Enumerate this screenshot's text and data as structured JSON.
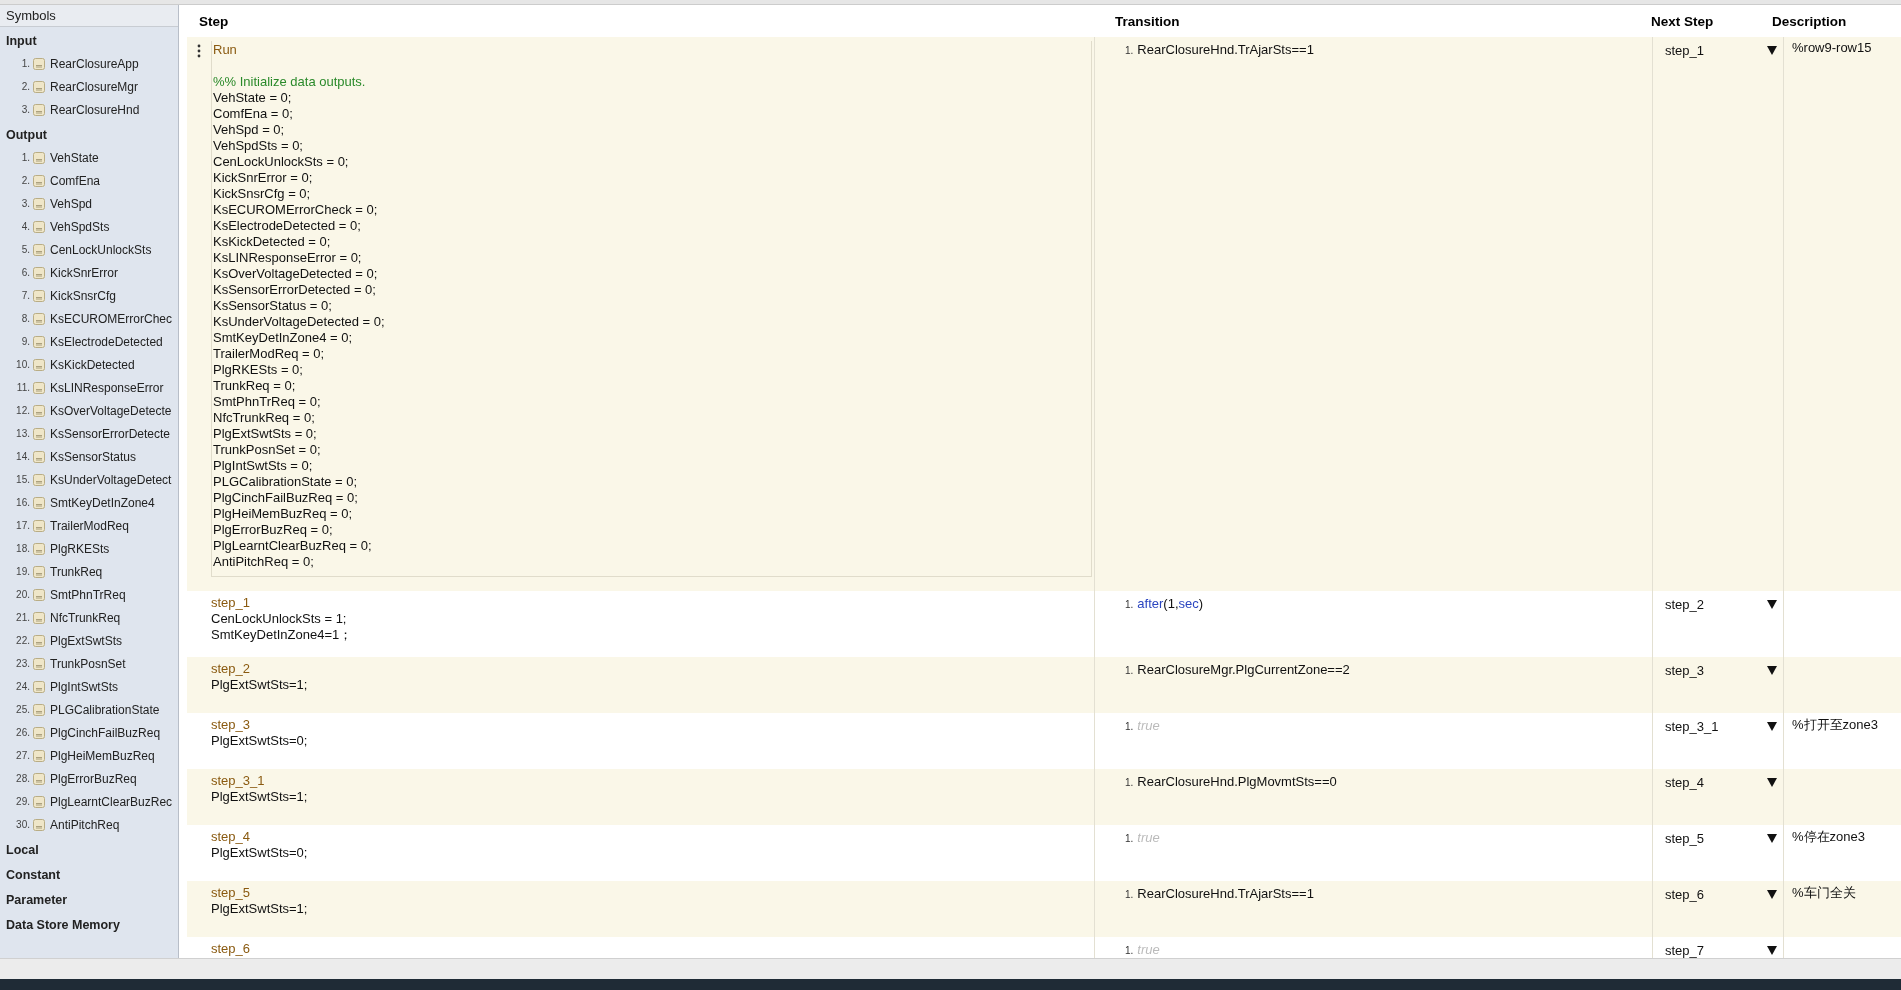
{
  "sidebar": {
    "title": "Symbols",
    "sections": [
      {
        "label": "Input",
        "items": [
          {
            "number": "1.",
            "name": "RearClosureApp"
          },
          {
            "number": "2.",
            "name": "RearClosureMgr"
          },
          {
            "number": "3.",
            "name": "RearClosureHnd"
          }
        ]
      },
      {
        "label": "Output",
        "items": [
          {
            "number": "1.",
            "name": "VehState"
          },
          {
            "number": "2.",
            "name": "ComfEna"
          },
          {
            "number": "3.",
            "name": "VehSpd"
          },
          {
            "number": "4.",
            "name": "VehSpdSts"
          },
          {
            "number": "5.",
            "name": "CenLockUnlockSts"
          },
          {
            "number": "6.",
            "name": "KickSnrError"
          },
          {
            "number": "7.",
            "name": "KickSnsrCfg"
          },
          {
            "number": "8.",
            "name": "KsECUROMErrorChec"
          },
          {
            "number": "9.",
            "name": "KsElectrodeDetected"
          },
          {
            "number": "10.",
            "name": "KsKickDetected"
          },
          {
            "number": "11.",
            "name": "KsLINResponseError"
          },
          {
            "number": "12.",
            "name": "KsOverVoltageDetecte"
          },
          {
            "number": "13.",
            "name": "KsSensorErrorDetecte"
          },
          {
            "number": "14.",
            "name": "KsSensorStatus"
          },
          {
            "number": "15.",
            "name": "KsUnderVoltageDetect"
          },
          {
            "number": "16.",
            "name": "SmtKeyDetInZone4"
          },
          {
            "number": "17.",
            "name": "TrailerModReq"
          },
          {
            "number": "18.",
            "name": "PlgRKESts"
          },
          {
            "number": "19.",
            "name": "TrunkReq"
          },
          {
            "number": "20.",
            "name": "SmtPhnTrReq"
          },
          {
            "number": "21.",
            "name": "NfcTrunkReq"
          },
          {
            "number": "22.",
            "name": "PlgExtSwtSts"
          },
          {
            "number": "23.",
            "name": "TrunkPosnSet"
          },
          {
            "number": "24.",
            "name": "PlgIntSwtSts"
          },
          {
            "number": "25.",
            "name": "PLGCalibrationState"
          },
          {
            "number": "26.",
            "name": "PlgCinchFailBuzReq"
          },
          {
            "number": "27.",
            "name": "PlgHeiMemBuzReq"
          },
          {
            "number": "28.",
            "name": "PlgErrorBuzReq"
          },
          {
            "number": "29.",
            "name": "PlgLearntClearBuzRec"
          },
          {
            "number": "30.",
            "name": "AntiPitchReq"
          }
        ]
      },
      {
        "label": "Local"
      },
      {
        "label": "Constant"
      },
      {
        "label": "Parameter"
      },
      {
        "label": "Data Store Memory"
      }
    ]
  },
  "table": {
    "columns": [
      "Step",
      "Transition",
      "Next Step",
      "Description"
    ],
    "rows": [
      {
        "step": "Run",
        "code": [
          {
            "kind": "comment",
            "text": "%% Initialize data outputs."
          },
          {
            "kind": "code",
            "text": "VehState = 0;"
          },
          {
            "kind": "code",
            "text": "ComfEna = 0;"
          },
          {
            "kind": "code",
            "text": "VehSpd = 0;"
          },
          {
            "kind": "code",
            "text": "VehSpdSts = 0;"
          },
          {
            "kind": "code",
            "text": "CenLockUnlockSts = 0;"
          },
          {
            "kind": "code",
            "text": "KickSnrError = 0;"
          },
          {
            "kind": "code",
            "text": "KickSnsrCfg = 0;"
          },
          {
            "kind": "code",
            "text": "KsECUROMErrorCheck = 0;"
          },
          {
            "kind": "code",
            "text": "KsElectrodeDetected = 0;"
          },
          {
            "kind": "code",
            "text": "KsKickDetected = 0;"
          },
          {
            "kind": "code",
            "text": "KsLINResponseError = 0;"
          },
          {
            "kind": "code",
            "text": "KsOverVoltageDetected = 0;"
          },
          {
            "kind": "code",
            "text": "KsSensorErrorDetected = 0;"
          },
          {
            "kind": "code",
            "text": "KsSensorStatus = 0;"
          },
          {
            "kind": "code",
            "text": "KsUnderVoltageDetected = 0;"
          },
          {
            "kind": "code",
            "text": "SmtKeyDetInZone4 = 0;"
          },
          {
            "kind": "code",
            "text": "TrailerModReq = 0;"
          },
          {
            "kind": "code",
            "text": "PlgRKESts = 0;"
          },
          {
            "kind": "code",
            "text": "TrunkReq = 0;"
          },
          {
            "kind": "code",
            "text": "SmtPhnTrReq = 0;"
          },
          {
            "kind": "code",
            "text": "NfcTrunkReq = 0;"
          },
          {
            "kind": "code",
            "text": "PlgExtSwtSts = 0;"
          },
          {
            "kind": "code",
            "text": "TrunkPosnSet = 0;"
          },
          {
            "kind": "code",
            "text": "PlgIntSwtSts = 0;"
          },
          {
            "kind": "code",
            "text": "PLGCalibrationState = 0;"
          },
          {
            "kind": "code",
            "text": "PlgCinchFailBuzReq = 0;"
          },
          {
            "kind": "code",
            "text": "PlgHeiMemBuzReq = 0;"
          },
          {
            "kind": "code",
            "text": "PlgErrorBuzReq = 0;"
          },
          {
            "kind": "code",
            "text": "PlgLearntClearBuzReq = 0;"
          },
          {
            "kind": "code",
            "text": "AntiPitchReq = 0;"
          }
        ],
        "selected": true,
        "transition": {
          "number": "1.",
          "tokens": [
            {
              "kind": "plain",
              "text": "RearClosureHnd.TrAjarSts==1"
            }
          ]
        },
        "next_step": "step_1",
        "description": "%row9-row15"
      },
      {
        "step": "step_1",
        "code": [
          {
            "kind": "code",
            "text": "CenLockUnlockSts = 1;"
          },
          {
            "kind": "code",
            "text": "SmtKeyDetInZone4=1；"
          }
        ],
        "selected": false,
        "transition": {
          "number": "1.",
          "tokens": [
            {
              "kind": "keyword",
              "text": "after"
            },
            {
              "kind": "plain",
              "text": "(1,"
            },
            {
              "kind": "keyword",
              "text": "sec"
            },
            {
              "kind": "plain",
              "text": ")"
            }
          ]
        },
        "next_step": "step_2"
      },
      {
        "step": "step_2",
        "code": [
          {
            "kind": "code",
            "text": "PlgExtSwtSts=1;"
          }
        ],
        "selected": false,
        "transition": {
          "number": "1.",
          "tokens": [
            {
              "kind": "plain",
              "text": "RearClosureMgr.PlgCurrentZone==2"
            }
          ]
        },
        "next_step": "step_3"
      },
      {
        "step": "step_3",
        "code": [
          {
            "kind": "code",
            "text": "PlgExtSwtSts=0;"
          }
        ],
        "selected": false,
        "transition": {
          "number": "1.",
          "tokens": [
            {
              "kind": "default",
              "text": "true"
            }
          ]
        },
        "next_step": "step_3_1",
        "description": "%打开至zone3"
      },
      {
        "step": "step_3_1",
        "code": [
          {
            "kind": "code",
            "text": "PlgExtSwtSts=1;"
          }
        ],
        "selected": false,
        "transition": {
          "number": "1.",
          "tokens": [
            {
              "kind": "plain",
              "text": "RearClosureHnd.PlgMovmtSts==0"
            }
          ]
        },
        "next_step": "step_4"
      },
      {
        "step": "step_4",
        "code": [
          {
            "kind": "code",
            "text": "PlgExtSwtSts=0;"
          }
        ],
        "selected": false,
        "transition": {
          "number": "1.",
          "tokens": [
            {
              "kind": "default",
              "text": "true"
            }
          ]
        },
        "next_step": "step_5",
        "description": "%停在zone3"
      },
      {
        "step": "step_5",
        "code": [
          {
            "kind": "code",
            "text": "PlgExtSwtSts=1;"
          }
        ],
        "selected": false,
        "transition": {
          "number": "1.",
          "tokens": [
            {
              "kind": "plain",
              "text": "RearClosureHnd.TrAjarSts==1"
            }
          ]
        },
        "next_step": "step_6",
        "description": "%车门全关"
      },
      {
        "step": "step_6",
        "code": [],
        "selected": false,
        "transition": {
          "number": "1.",
          "tokens": [
            {
              "kind": "default",
              "text": "true"
            }
          ]
        },
        "next_step": "step_7"
      }
    ]
  }
}
